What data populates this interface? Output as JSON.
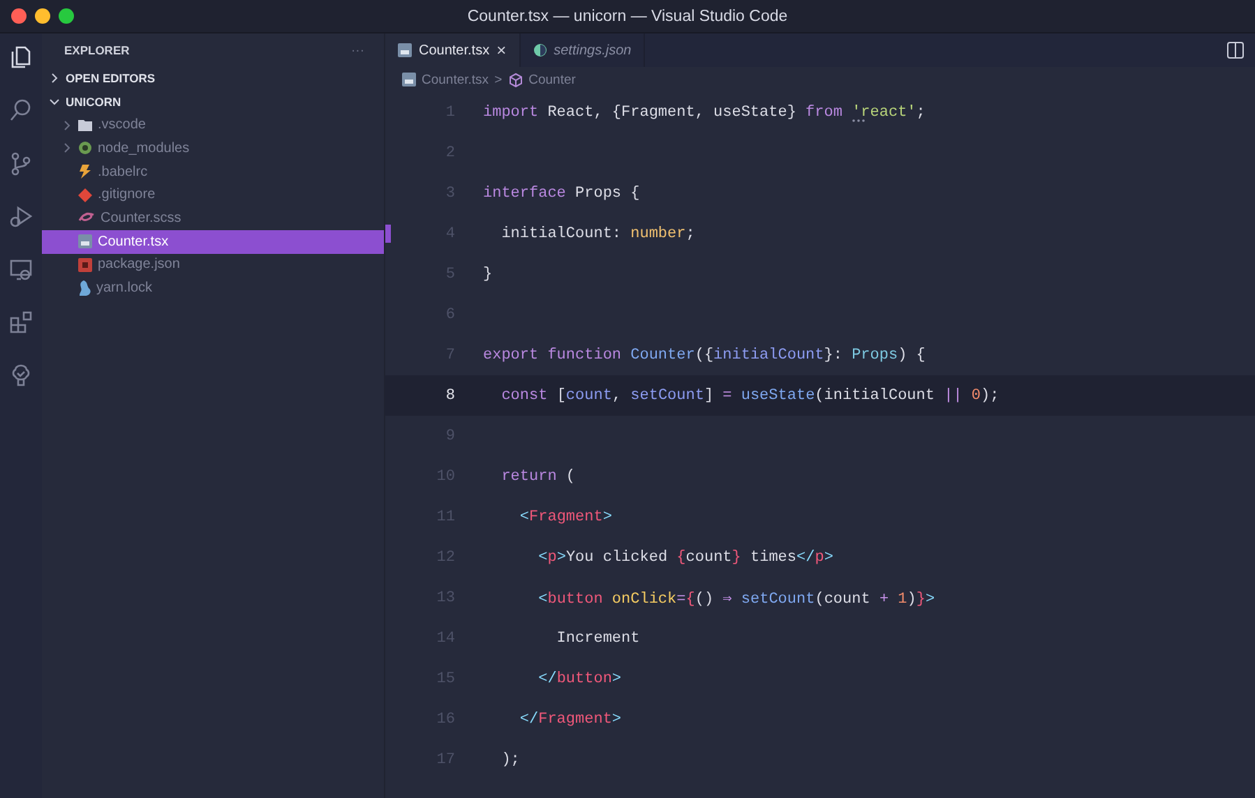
{
  "window": {
    "title": "Counter.tsx — unicorn — Visual Studio Code"
  },
  "activity_bar": [
    {
      "kind": "files",
      "selected": true
    },
    {
      "kind": "search",
      "selected": false
    },
    {
      "kind": "branch",
      "selected": false
    },
    {
      "kind": "debug",
      "selected": false
    },
    {
      "kind": "remote",
      "selected": false
    },
    {
      "kind": "extensions",
      "selected": false
    },
    {
      "kind": "tree",
      "selected": false
    }
  ],
  "explorer": {
    "title": "EXPLORER",
    "more": "···",
    "sections": [
      {
        "label": "OPEN EDITORS",
        "expanded": false
      },
      {
        "label": "UNICORN",
        "expanded": true,
        "children": [
          {
            "name": ".vscode",
            "kind": "folder",
            "folder": true,
            "selected": false
          },
          {
            "name": "node_modules",
            "kind": "node",
            "folder": true,
            "selected": false
          },
          {
            "name": ".babelrc",
            "kind": "babel",
            "folder": false,
            "selected": false
          },
          {
            "name": ".gitignore",
            "kind": "git",
            "folder": false,
            "selected": false
          },
          {
            "name": "Counter.scss",
            "kind": "sass",
            "folder": false,
            "selected": false
          },
          {
            "name": "Counter.tsx",
            "kind": "tsx",
            "folder": false,
            "selected": true
          },
          {
            "name": "package.json",
            "kind": "json",
            "folder": false,
            "selected": false
          },
          {
            "name": "yarn.lock",
            "kind": "yarn",
            "folder": false,
            "selected": false
          }
        ]
      }
    ]
  },
  "tabs": [
    {
      "label": "Counter.tsx",
      "kind": "tsx",
      "selected": true,
      "preview": false,
      "close": "×"
    },
    {
      "label": "settings.json",
      "kind": "settings",
      "selected": false,
      "preview": true
    }
  ],
  "breadcrumb": [
    {
      "label": "Counter.tsx",
      "kind": "tsx"
    },
    {
      "label": "Counter",
      "kind": "symbol"
    }
  ],
  "breadcrumb_separator": ">",
  "editor": {
    "lines": [
      {
        "number": "1",
        "current": false,
        "changed": false,
        "hint": true,
        "tokens": [
          {
            "kind": "kw",
            "text": "import"
          },
          {
            "kind": "plain",
            "text": " React, {Fragment, useState} "
          },
          {
            "kind": "kw",
            "text": "from "
          },
          {
            "kind": "str",
            "text": "'react'"
          },
          {
            "kind": "plain",
            "text": ";"
          }
        ]
      },
      {
        "number": "2",
        "current": false,
        "changed": false,
        "hint": false
      },
      {
        "number": "3",
        "current": false,
        "changed": false,
        "hint": false,
        "tokens": [
          {
            "kind": "kw",
            "text": "interface"
          },
          {
            "kind": "plain",
            "text": " Props {"
          }
        ]
      },
      {
        "number": "4",
        "current": false,
        "changed": true,
        "hint": false,
        "tokens": [
          {
            "kind": "plain",
            "text": "  initialCount: "
          },
          {
            "kind": "type",
            "text": "number"
          },
          {
            "kind": "plain",
            "text": ";"
          }
        ]
      },
      {
        "number": "5",
        "current": false,
        "changed": false,
        "hint": false,
        "tokens": [
          {
            "kind": "plain",
            "text": "}"
          }
        ]
      },
      {
        "number": "6",
        "current": false,
        "changed": false,
        "hint": false
      },
      {
        "number": "7",
        "current": false,
        "changed": false,
        "hint": false,
        "tokens": [
          {
            "kind": "kw",
            "text": "export function "
          },
          {
            "kind": "func",
            "text": "Counter"
          },
          {
            "kind": "plain",
            "text": "({"
          },
          {
            "kind": "param",
            "text": "initialCount"
          },
          {
            "kind": "plain",
            "text": "}: "
          },
          {
            "kind": "cls",
            "text": "Props"
          },
          {
            "kind": "plain",
            "text": ") {"
          }
        ]
      },
      {
        "number": "8",
        "current": true,
        "changed": false,
        "hint": false,
        "tokens": [
          {
            "kind": "kw",
            "text": "  const"
          },
          {
            "kind": "plain",
            "text": " ["
          },
          {
            "kind": "param",
            "text": "count"
          },
          {
            "kind": "plain",
            "text": ", "
          },
          {
            "kind": "param",
            "text": "setCount"
          },
          {
            "kind": "plain",
            "text": "] "
          },
          {
            "kind": "op",
            "text": "= "
          },
          {
            "kind": "func",
            "text": "useState"
          },
          {
            "kind": "plain",
            "text": "(initialCount "
          },
          {
            "kind": "op",
            "text": "|| "
          },
          {
            "kind": "num",
            "text": "0"
          },
          {
            "kind": "plain",
            "text": ");"
          }
        ]
      },
      {
        "number": "9",
        "current": false,
        "changed": false,
        "hint": false
      },
      {
        "number": "10",
        "current": false,
        "changed": false,
        "hint": false,
        "tokens": [
          {
            "kind": "kw",
            "text": "  return"
          },
          {
            "kind": "plain",
            "text": " ("
          }
        ]
      },
      {
        "number": "11",
        "current": false,
        "changed": false,
        "hint": false,
        "tokens": [
          {
            "kind": "bracket",
            "text": "    <"
          },
          {
            "kind": "tag",
            "text": "Fragment"
          },
          {
            "kind": "bracket",
            "text": ">"
          }
        ]
      },
      {
        "number": "12",
        "current": false,
        "changed": false,
        "hint": false,
        "tokens": [
          {
            "kind": "bracket",
            "text": "      <"
          },
          {
            "kind": "tag",
            "text": "p"
          },
          {
            "kind": "bracket",
            "text": ">"
          },
          {
            "kind": "plain",
            "text": "You clicked "
          },
          {
            "kind": "brace",
            "text": "{"
          },
          {
            "kind": "plain",
            "text": "count"
          },
          {
            "kind": "brace",
            "text": "}"
          },
          {
            "kind": "plain",
            "text": " times"
          },
          {
            "kind": "bracket",
            "text": "</"
          },
          {
            "kind": "tag",
            "text": "p"
          },
          {
            "kind": "bracket",
            "text": ">"
          }
        ]
      },
      {
        "number": "13",
        "current": false,
        "changed": false,
        "hint": false,
        "tokens": [
          {
            "kind": "bracket",
            "text": "      <"
          },
          {
            "kind": "tag",
            "text": "button"
          },
          {
            "kind": "attr",
            "text": " onClick"
          },
          {
            "kind": "op",
            "text": "="
          },
          {
            "kind": "brace",
            "text": "{"
          },
          {
            "kind": "plain",
            "text": "() "
          },
          {
            "kind": "op",
            "text": "⇒ "
          },
          {
            "kind": "func",
            "text": "setCount"
          },
          {
            "kind": "plain",
            "text": "(count "
          },
          {
            "kind": "op",
            "text": "+ "
          },
          {
            "kind": "num",
            "text": "1"
          },
          {
            "kind": "plain",
            "text": ")"
          },
          {
            "kind": "brace",
            "text": "}"
          },
          {
            "kind": "bracket",
            "text": ">"
          }
        ]
      },
      {
        "number": "14",
        "current": false,
        "changed": false,
        "hint": false,
        "tokens": [
          {
            "kind": "plain",
            "text": "        Increment"
          }
        ]
      },
      {
        "number": "15",
        "current": false,
        "changed": false,
        "hint": false,
        "tokens": [
          {
            "kind": "bracket",
            "text": "      </"
          },
          {
            "kind": "tag",
            "text": "button"
          },
          {
            "kind": "bracket",
            "text": ">"
          }
        ]
      },
      {
        "number": "16",
        "current": false,
        "changed": false,
        "hint": false,
        "tokens": [
          {
            "kind": "bracket",
            "text": "    </"
          },
          {
            "kind": "tag",
            "text": "Fragment"
          },
          {
            "kind": "bracket",
            "text": ">"
          }
        ]
      },
      {
        "number": "17",
        "current": false,
        "changed": false,
        "hint": false,
        "tokens": [
          {
            "kind": "plain",
            "text": "  );"
          }
        ]
      }
    ]
  }
}
